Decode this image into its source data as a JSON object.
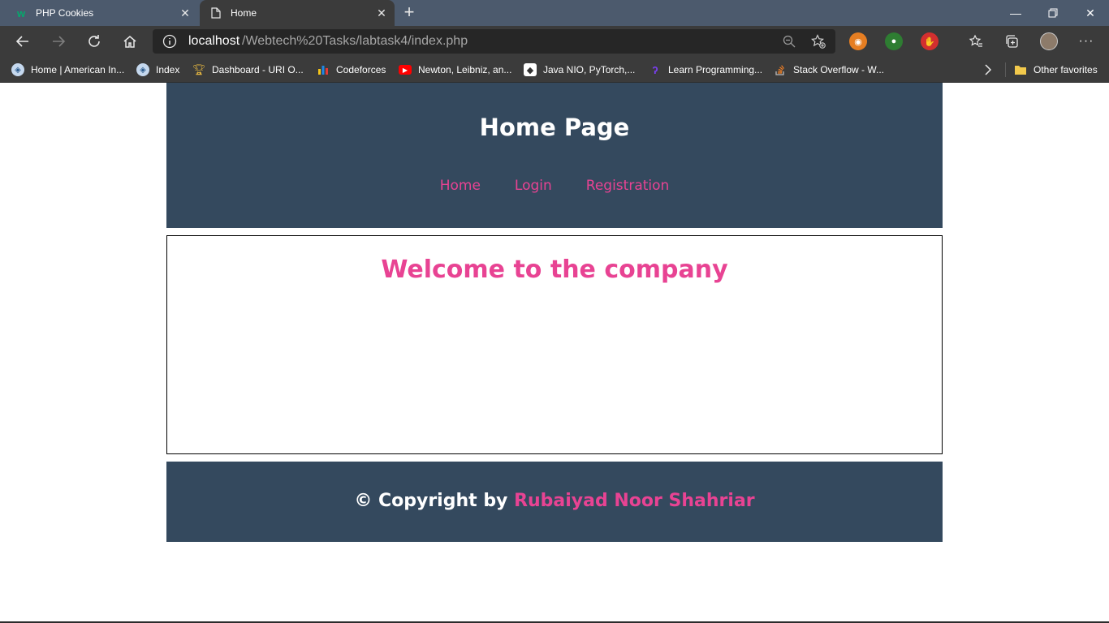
{
  "browser": {
    "tabs": [
      {
        "title": "PHP Cookies",
        "favicon": "w3schools-icon",
        "active": false
      },
      {
        "title": "Home",
        "favicon": "page-icon",
        "active": true
      }
    ],
    "address": {
      "host": "localhost",
      "path": "/Webtech%20Tasks/labtask4/index.php"
    },
    "bookmarks": [
      {
        "label": "Home | American In...",
        "icon": "aiub-icon"
      },
      {
        "label": "Index",
        "icon": "aiub-icon"
      },
      {
        "label": "Dashboard - URI O...",
        "icon": "trophy-icon"
      },
      {
        "label": "Codeforces",
        "icon": "codeforces-icon"
      },
      {
        "label": "Newton, Leibniz, an...",
        "icon": "youtube-icon"
      },
      {
        "label": "Java NIO, PyTorch,...",
        "icon": "site-icon"
      },
      {
        "label": "Learn Programming...",
        "icon": "programiz-icon"
      },
      {
        "label": "Stack Overflow - W...",
        "icon": "stackoverflow-icon"
      }
    ],
    "other_favorites": "Other favorites",
    "colors": {
      "tabstrip": "#4c5a6d",
      "toolbar": "#3b3b3b"
    }
  },
  "page": {
    "title": "Home Page",
    "nav": [
      "Home",
      "Login",
      "Registration"
    ],
    "welcome": "Welcome to the company",
    "footer": {
      "prefix": "© Copyright by ",
      "author": "Rubaiyad Noor Shahriar"
    },
    "colors": {
      "header_bg": "#34495e",
      "accent": "#e84393",
      "text": "#ffffff"
    }
  }
}
